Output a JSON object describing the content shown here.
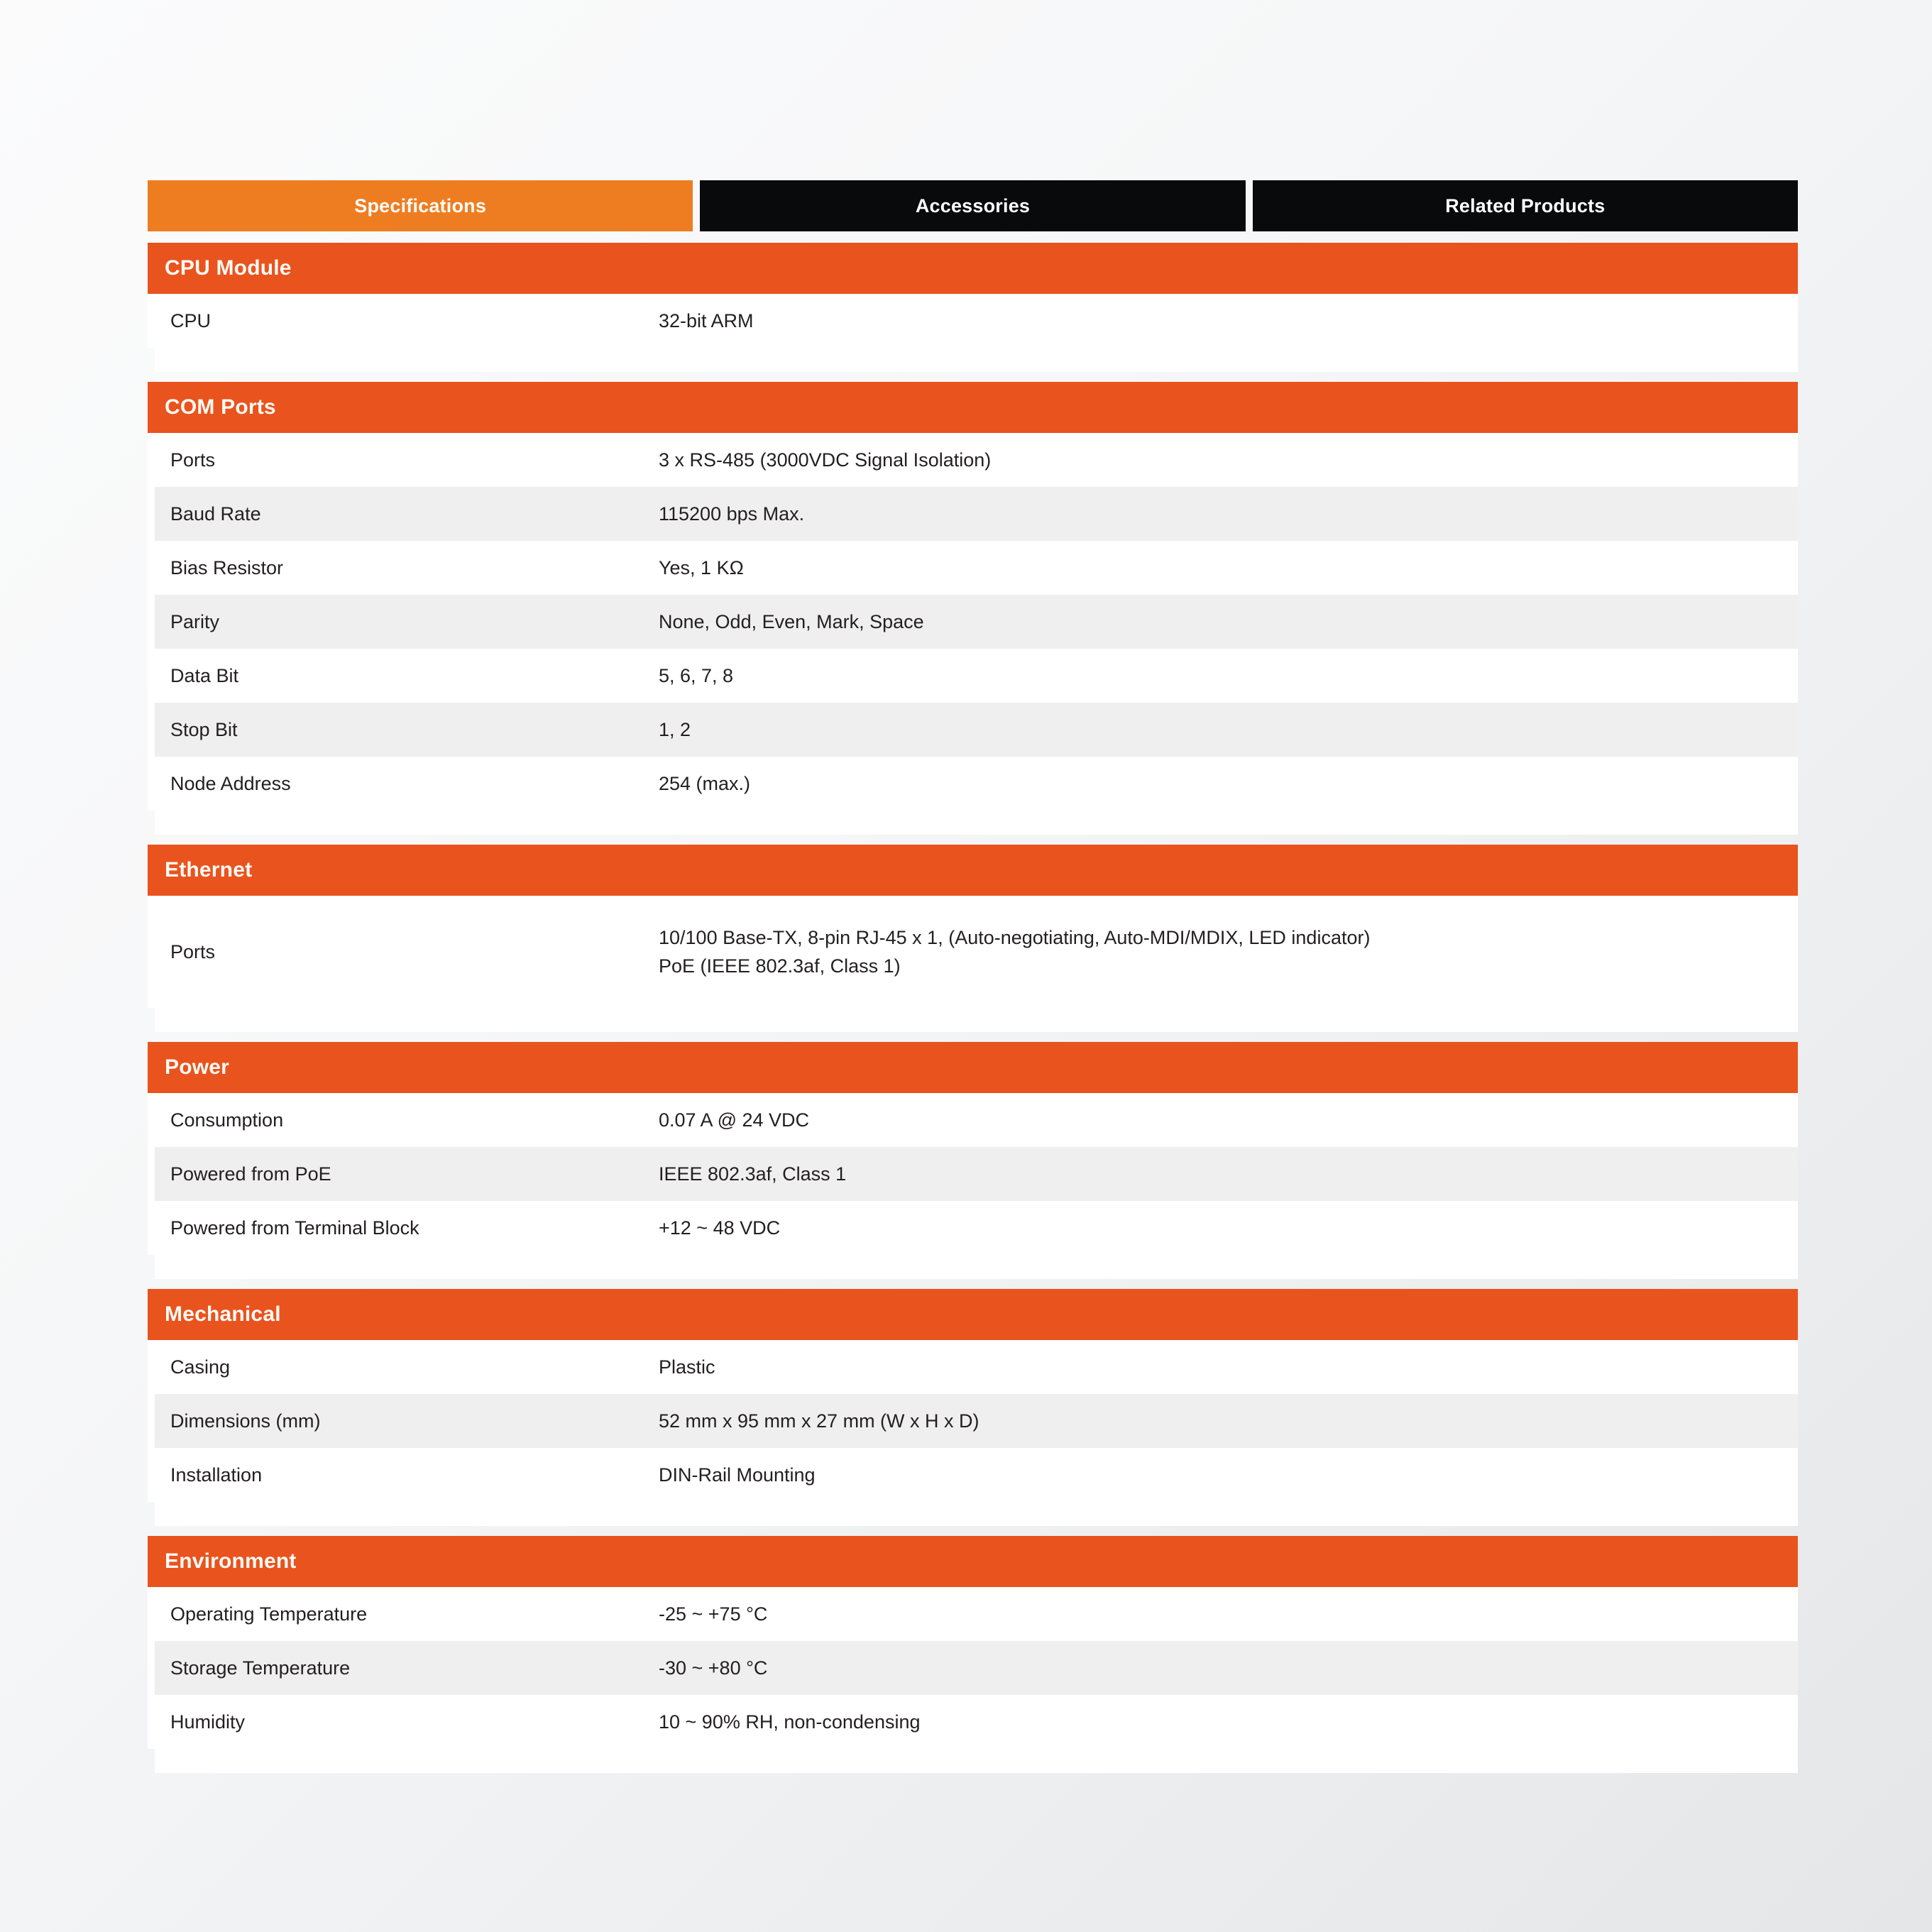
{
  "tabs": [
    {
      "label": "Specifications",
      "active": true
    },
    {
      "label": "Accessories",
      "active": false
    },
    {
      "label": "Related Products",
      "active": false
    }
  ],
  "colors": {
    "tab_active": "#ee7d22",
    "tab_inactive": "#080a0b",
    "section_header": "#e9531e",
    "row_alt": "#efefef",
    "row_base": "#ffffff",
    "text": "#231f20"
  },
  "sections": [
    {
      "title": "CPU Module",
      "rows": [
        {
          "label": "CPU",
          "value": "32-bit ARM"
        }
      ]
    },
    {
      "title": "COM Ports",
      "rows": [
        {
          "label": "Ports",
          "value": "3 x RS-485 (3000VDC Signal Isolation)"
        },
        {
          "label": "Baud Rate",
          "value": "115200 bps Max."
        },
        {
          "label": "Bias Resistor",
          "value": "Yes, 1 KΩ"
        },
        {
          "label": "Parity",
          "value": "None, Odd, Even, Mark, Space"
        },
        {
          "label": "Data Bit",
          "value": "5, 6, 7, 8"
        },
        {
          "label": "Stop Bit",
          "value": "1, 2"
        },
        {
          "label": "Node Address",
          "value": "254 (max.)"
        }
      ]
    },
    {
      "title": "Ethernet",
      "rows": [
        {
          "label": "Ports",
          "value": "10/100 Base-TX, 8-pin RJ-45 x 1, (Auto-negotiating, Auto-MDI/MDIX, LED indicator)\nPoE (IEEE 802.3af, Class 1)",
          "tall": true
        }
      ]
    },
    {
      "title": "Power",
      "rows": [
        {
          "label": "Consumption",
          "value": "0.07 A @ 24 VDC"
        },
        {
          "label": "Powered from PoE",
          "value": "IEEE 802.3af, Class 1"
        },
        {
          "label": "Powered from Terminal Block",
          "value": "+12 ~ 48 VDC"
        }
      ]
    },
    {
      "title": "Mechanical",
      "rows": [
        {
          "label": "Casing",
          "value": "Plastic"
        },
        {
          "label": "Dimensions (mm)",
          "value": "52 mm x 95 mm x 27 mm (W x H x D)"
        },
        {
          "label": "Installation",
          "value": "DIN-Rail Mounting"
        }
      ]
    },
    {
      "title": "Environment",
      "rows": [
        {
          "label": "Operating Temperature",
          "value": "-25 ~ +75 °C"
        },
        {
          "label": "Storage Temperature",
          "value": "-30 ~ +80 °C"
        },
        {
          "label": "Humidity",
          "value": "10 ~ 90% RH, non-condensing"
        }
      ]
    }
  ]
}
